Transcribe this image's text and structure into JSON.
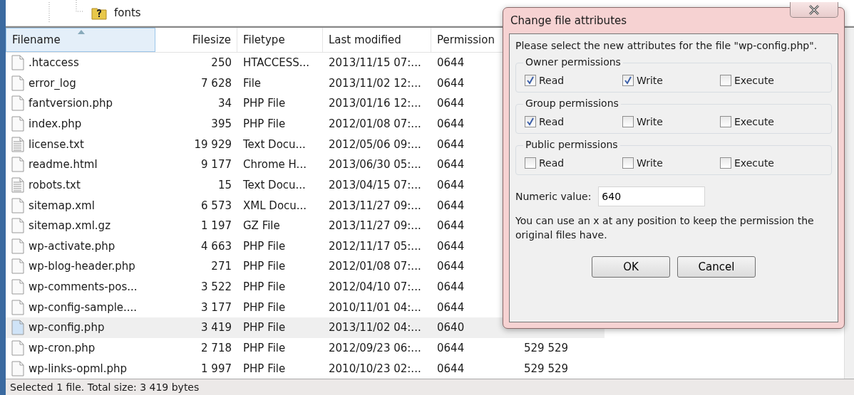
{
  "tree": {
    "label": "fonts"
  },
  "table": {
    "columns": [
      {
        "label": "Filename",
        "sorted": true
      },
      {
        "label": "Filesize",
        "sorted": false
      },
      {
        "label": "Filetype",
        "sorted": false
      },
      {
        "label": "Last modified",
        "sorted": false
      },
      {
        "label": "Permission",
        "sorted": false
      }
    ],
    "rows": [
      {
        "kind": "file",
        "filename": ".htaccess",
        "filesize": "250",
        "filetype": "HTACCESS...",
        "last_modified": "2013/11/15 07:...",
        "permissions": "0644",
        "selected": false
      },
      {
        "kind": "file",
        "filename": "error_log",
        "filesize": "7 628",
        "filetype": "File",
        "last_modified": "2013/11/02 12:...",
        "permissions": "0644",
        "selected": false
      },
      {
        "kind": "file",
        "filename": "fantversion.php",
        "filesize": "34",
        "filetype": "PHP File",
        "last_modified": "2013/01/16 12:...",
        "permissions": "0644",
        "selected": false
      },
      {
        "kind": "file",
        "filename": "index.php",
        "filesize": "395",
        "filetype": "PHP File",
        "last_modified": "2012/01/08 07:...",
        "permissions": "0644",
        "selected": false
      },
      {
        "kind": "text",
        "filename": "license.txt",
        "filesize": "19 929",
        "filetype": "Text Docu...",
        "last_modified": "2012/05/06 09:...",
        "permissions": "0644",
        "selected": false
      },
      {
        "kind": "file",
        "filename": "readme.html",
        "filesize": "9 177",
        "filetype": "Chrome H...",
        "last_modified": "2013/06/30 05:...",
        "permissions": "0644",
        "selected": false
      },
      {
        "kind": "text",
        "filename": "robots.txt",
        "filesize": "15",
        "filetype": "Text Docu...",
        "last_modified": "2013/04/15 07:...",
        "permissions": "0644",
        "selected": false
      },
      {
        "kind": "file",
        "filename": "sitemap.xml",
        "filesize": "6 573",
        "filetype": "XML Docu...",
        "last_modified": "2013/11/27 09:...",
        "permissions": "0644",
        "selected": false
      },
      {
        "kind": "file",
        "filename": "sitemap.xml.gz",
        "filesize": "1 197",
        "filetype": "GZ File",
        "last_modified": "2013/11/27 09:...",
        "permissions": "0644",
        "selected": false
      },
      {
        "kind": "file",
        "filename": "wp-activate.php",
        "filesize": "4 663",
        "filetype": "PHP File",
        "last_modified": "2012/11/17 05:...",
        "permissions": "0644",
        "selected": false
      },
      {
        "kind": "file",
        "filename": "wp-blog-header.php",
        "filesize": "271",
        "filetype": "PHP File",
        "last_modified": "2012/01/08 07:...",
        "permissions": "0644",
        "selected": false
      },
      {
        "kind": "file",
        "filename": "wp-comments-pos...",
        "filesize": "3 522",
        "filetype": "PHP File",
        "last_modified": "2012/04/10 07:...",
        "permissions": "0644",
        "selected": false
      },
      {
        "kind": "file",
        "filename": "wp-config-sample....",
        "filesize": "3 177",
        "filetype": "PHP File",
        "last_modified": "2010/11/01 04:...",
        "permissions": "0644",
        "selected": false
      },
      {
        "kind": "file",
        "filename": "wp-config.php",
        "filesize": "3 419",
        "filetype": "PHP File",
        "last_modified": "2013/11/02 04:...",
        "permissions": "0640",
        "selected": true
      },
      {
        "kind": "file",
        "filename": "wp-cron.php",
        "filesize": "2 718",
        "filetype": "PHP File",
        "last_modified": "2012/09/23 06:...",
        "permissions": "0644",
        "owner": "529 529",
        "selected": false
      },
      {
        "kind": "file",
        "filename": "wp-links-opml.php",
        "filesize": "1 997",
        "filetype": "PHP File",
        "last_modified": "2010/10/23 02:...",
        "permissions": "0644",
        "owner": "529 529",
        "selected": false
      }
    ]
  },
  "status_bar": "Selected 1 file. Total size: 3 419 bytes",
  "dialog": {
    "title": "Change file attributes",
    "prompt": "Please select the new attributes for the file \"wp-config.php\".",
    "groups": [
      {
        "label": "Owner permissions",
        "options": [
          {
            "label": "Read",
            "checked": true
          },
          {
            "label": "Write",
            "checked": true
          },
          {
            "label": "Execute",
            "checked": false
          }
        ]
      },
      {
        "label": "Group permissions",
        "options": [
          {
            "label": "Read",
            "checked": true
          },
          {
            "label": "Write",
            "checked": false
          },
          {
            "label": "Execute",
            "checked": false
          }
        ]
      },
      {
        "label": "Public permissions",
        "options": [
          {
            "label": "Read",
            "checked": false
          },
          {
            "label": "Write",
            "checked": false
          },
          {
            "label": "Execute",
            "checked": false
          }
        ]
      }
    ],
    "numeric_label": "Numeric value:",
    "numeric_value": "640",
    "note": "You can use an x at any position to keep the permission the original files have.",
    "buttons": [
      "OK",
      "Cancel"
    ]
  }
}
